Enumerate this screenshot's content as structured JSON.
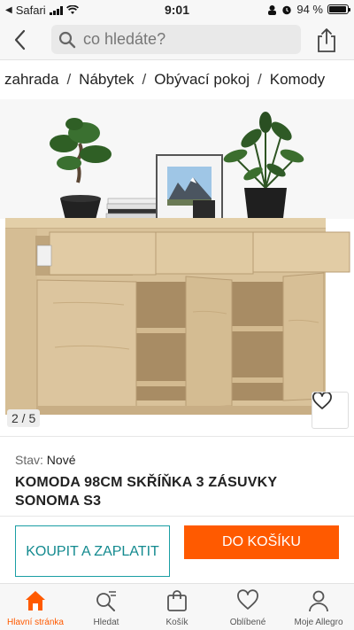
{
  "status_bar": {
    "carrier": "Safari",
    "time": "9:01",
    "battery": "94 %",
    "battery_level": 0.94
  },
  "header": {
    "search_placeholder": "co hledáte?"
  },
  "breadcrumb": [
    "zahrada",
    "Nábytek",
    "Obývací pokoj",
    "Komody"
  ],
  "gallery": {
    "counter": "2 / 5",
    "photo_index": 2,
    "photo_total": 5
  },
  "product": {
    "condition_label": "Stav:",
    "condition_value": "Nové",
    "title": "KOMODA 98CM SKŘÍŇKA 3 ZÁSUVKY SONOMA S3"
  },
  "actions": {
    "buy_label": "KOUPIT A ZAPLATIT",
    "cart_label": "DO KOŠÍKU"
  },
  "bottom_nav": [
    {
      "label": "Hlavní stránka",
      "icon": "home-icon",
      "active": true
    },
    {
      "label": "Hledat",
      "icon": "search-list-icon",
      "active": false
    },
    {
      "label": "Košík",
      "icon": "bag-icon",
      "active": false
    },
    {
      "label": "Oblíbené",
      "icon": "heart-icon",
      "active": false
    },
    {
      "label": "Moje Allegro",
      "icon": "user-icon",
      "active": false
    }
  ],
  "colors": {
    "accent": "#ff5a00",
    "teal": "#1a9ea4",
    "wood": "#d9c29a"
  }
}
